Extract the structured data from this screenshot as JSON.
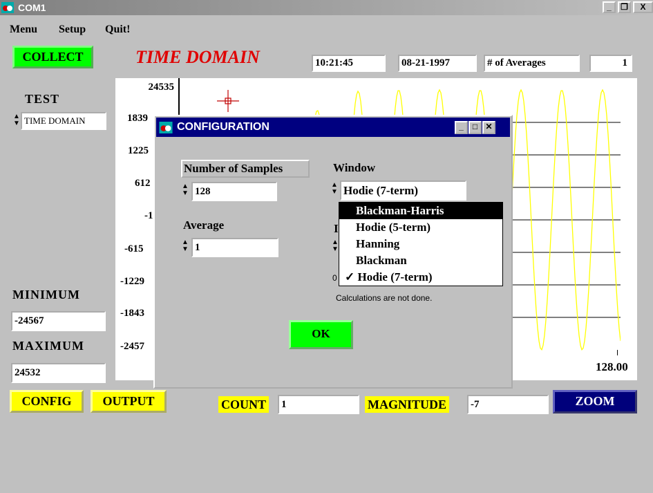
{
  "window": {
    "title": "COM1",
    "controls": [
      "_",
      "❐",
      "X"
    ]
  },
  "menu": {
    "items": [
      "Menu",
      "Setup",
      "Quit!"
    ]
  },
  "toolbar": {
    "collect_label": "COLLECT",
    "mode_title": "TIME DOMAIN",
    "time": "10:21:45",
    "date": "08-21-1997",
    "averages_label": "# of Averages",
    "averages_value": "1"
  },
  "left_panel": {
    "test_label": "TEST",
    "test_value": "TIME DOMAIN",
    "minimum_label": "MINIMUM",
    "minimum_value": "-24567",
    "maximum_label": "MAXIMUM",
    "maximum_value": "24532"
  },
  "plot": {
    "y_ticks": [
      "24535",
      "1839",
      "1225",
      "612",
      "-1",
      "-615",
      "-1229",
      "-1843",
      "-2457"
    ],
    "x_end_label": "128.00"
  },
  "bottom_bar": {
    "config_label": "CONFIG",
    "output_label": "OUTPUT",
    "count_label": "COUNT",
    "count_value": "1",
    "magnitude_label": "MAGNITUDE",
    "magnitude_value": "-7",
    "zoom_label": "ZOOM"
  },
  "dialog": {
    "title": "CONFIGURATION",
    "samples_label": "Number of Samples",
    "samples_value": "128",
    "average_label": "Average",
    "average_value": "1",
    "window_label": "Window",
    "window_value": "Hodie (7-term)",
    "window_options": [
      "Blackman-Harris",
      "Hodie (5-term)",
      "Hanning",
      "Blackman",
      "✓ Hodie (7-term)"
    ],
    "highlighted_option": "Blackman-Harris",
    "hidden_label_fragment": "I",
    "status_prefix": "0",
    "status_text": "Calculations are not done.",
    "ok_label": "OK"
  },
  "colors": {
    "plot_wave": "#ffff00",
    "plot_bg": "#ffffff",
    "dialog_title": "#000080",
    "accent_red": "#e00000"
  }
}
